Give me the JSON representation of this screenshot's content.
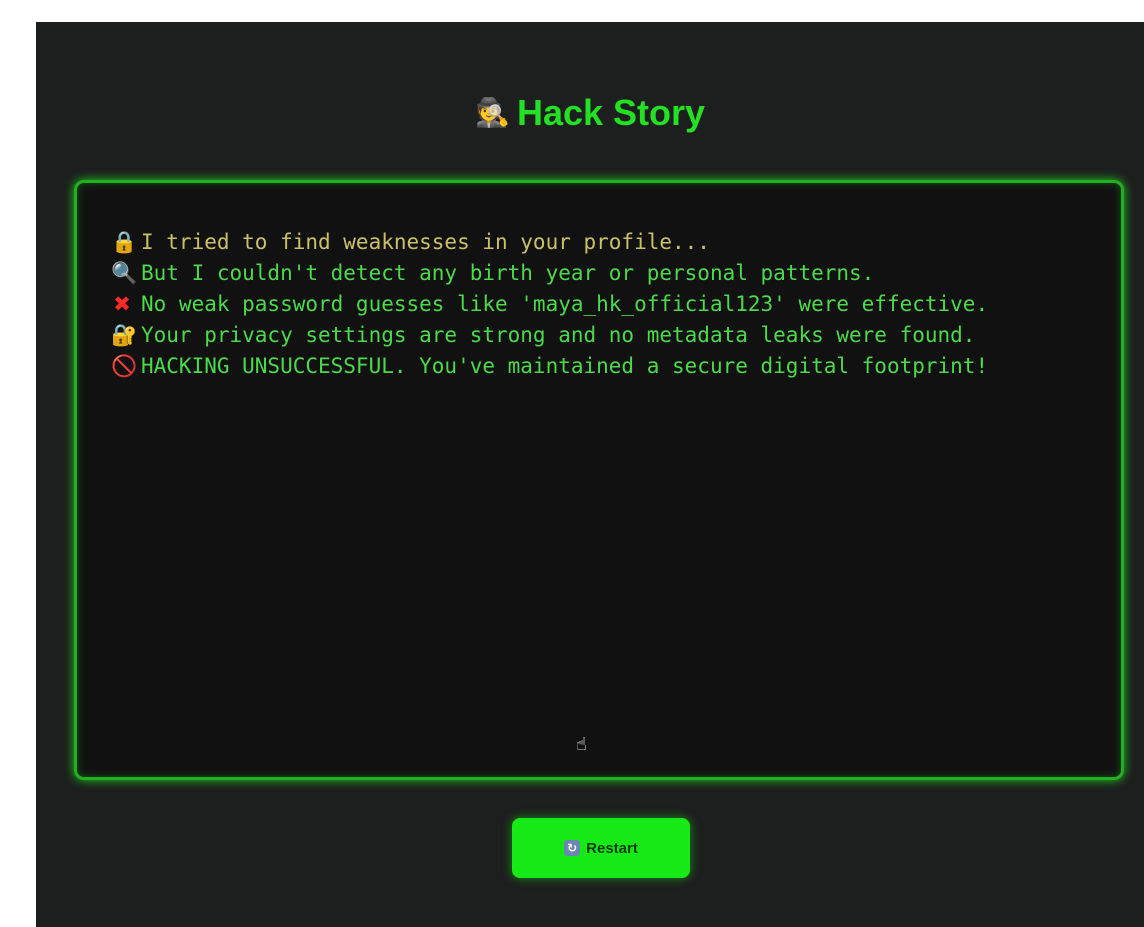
{
  "app": {
    "title": "Hack Story",
    "title_icon": "detective-icon",
    "title_icon_glyph": "🕵",
    "accent_color": "#22e022",
    "background_color": "#1d1e1e",
    "panel_color": "#111111"
  },
  "story": {
    "lines": [
      {
        "icon": "lock-icon",
        "glyph": "🔒",
        "text": "I tried to find weaknesses in your profile..."
      },
      {
        "icon": "magnifying-glass-icon",
        "glyph": "🔍",
        "text": "But I couldn't detect any birth year or personal patterns."
      },
      {
        "icon": "cross-mark-icon",
        "glyph": "✖",
        "text": "No weak password guesses like 'maya_hk_official123' were effective."
      },
      {
        "icon": "safe-icon",
        "glyph": "🔐",
        "text": "Your privacy settings are strong and no metadata leaks were found."
      },
      {
        "icon": "prohibited-icon",
        "glyph": "⃠",
        "text": "HACKING UNSUCCESSFUL. You've maintained a secure digital footprint!"
      }
    ]
  },
  "controls": {
    "restart_icon": "refresh-icon",
    "restart_glyph": "↻",
    "restart_label": "Restart"
  },
  "cursor": {
    "icon": "hand-pointer-icon",
    "glyph": "☝"
  }
}
